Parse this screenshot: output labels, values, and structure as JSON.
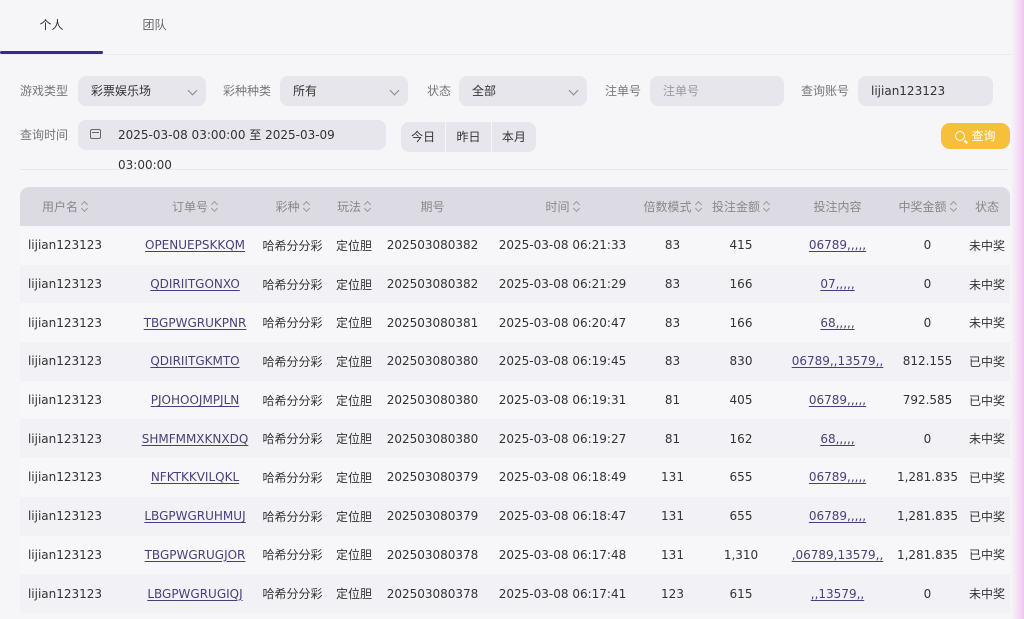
{
  "tabs": [
    {
      "label": "个人"
    },
    {
      "label": "团队"
    }
  ],
  "filters": {
    "game_type": {
      "label": "游戏类型",
      "value": "彩票娱乐场"
    },
    "lottery_kind": {
      "label": "彩种种类",
      "value": "所有"
    },
    "status": {
      "label": "状态",
      "value": "全部"
    },
    "order_no": {
      "label": "注单号",
      "placeholder": "注单号"
    },
    "account": {
      "label": "查询账号",
      "value": "lijian123123"
    },
    "time": {
      "label": "查询时间",
      "value": "2025-03-08 03:00:00 至 2025-03-09 03:00:00"
    },
    "quick": [
      {
        "label": "今日"
      },
      {
        "label": "昨日"
      },
      {
        "label": "本月"
      }
    ],
    "query_button": "查询"
  },
  "table": {
    "headers": {
      "user": "用户名",
      "order": "订单号",
      "lottery": "彩种",
      "play": "玩法",
      "issue": "期号",
      "time": "时间",
      "multiplier": "倍数模式",
      "amount": "投注金额",
      "content": "投注内容",
      "win": "中奖金额",
      "status": "状态"
    },
    "rows": [
      {
        "user": "lijian123123",
        "order": "OPENUEPSKKQM",
        "lottery": "哈希分分彩",
        "play": "定位胆",
        "issue": "202503080382",
        "time": "2025-03-08 06:21:33",
        "multiplier": "83",
        "amount": "415",
        "content": "06789,,,,,",
        "win": "0",
        "status": "未中奖"
      },
      {
        "user": "lijian123123",
        "order": "QDIRIITGONXO",
        "lottery": "哈希分分彩",
        "play": "定位胆",
        "issue": "202503080382",
        "time": "2025-03-08 06:21:29",
        "multiplier": "83",
        "amount": "166",
        "content": "07,,,,,",
        "win": "0",
        "status": "未中奖"
      },
      {
        "user": "lijian123123",
        "order": "TBGPWGRUKPNR",
        "lottery": "哈希分分彩",
        "play": "定位胆",
        "issue": "202503080381",
        "time": "2025-03-08 06:20:47",
        "multiplier": "83",
        "amount": "166",
        "content": "68,,,,,",
        "win": "0",
        "status": "未中奖"
      },
      {
        "user": "lijian123123",
        "order": "QDIRIITGKMTO",
        "lottery": "哈希分分彩",
        "play": "定位胆",
        "issue": "202503080380",
        "time": "2025-03-08 06:19:45",
        "multiplier": "83",
        "amount": "830",
        "content": "06789,,13579,,",
        "win": "812.155",
        "status": "已中奖"
      },
      {
        "user": "lijian123123",
        "order": "PJOHOOJMPJLN",
        "lottery": "哈希分分彩",
        "play": "定位胆",
        "issue": "202503080380",
        "time": "2025-03-08 06:19:31",
        "multiplier": "81",
        "amount": "405",
        "content": "06789,,,,,",
        "win": "792.585",
        "status": "已中奖"
      },
      {
        "user": "lijian123123",
        "order": "SHMFMMXKNXDQ",
        "lottery": "哈希分分彩",
        "play": "定位胆",
        "issue": "202503080380",
        "time": "2025-03-08 06:19:27",
        "multiplier": "81",
        "amount": "162",
        "content": "68,,,,,",
        "win": "0",
        "status": "未中奖"
      },
      {
        "user": "lijian123123",
        "order": "NFKTKKVILQKL",
        "lottery": "哈希分分彩",
        "play": "定位胆",
        "issue": "202503080379",
        "time": "2025-03-08 06:18:49",
        "multiplier": "131",
        "amount": "655",
        "content": "06789,,,,,",
        "win": "1,281.835",
        "status": "已中奖"
      },
      {
        "user": "lijian123123",
        "order": "LBGPWGRUHMUJ",
        "lottery": "哈希分分彩",
        "play": "定位胆",
        "issue": "202503080379",
        "time": "2025-03-08 06:18:47",
        "multiplier": "131",
        "amount": "655",
        "content": "06789,,,,,",
        "win": "1,281.835",
        "status": "已中奖"
      },
      {
        "user": "lijian123123",
        "order": "TBGPWGRUGJOR",
        "lottery": "哈希分分彩",
        "play": "定位胆",
        "issue": "202503080378",
        "time": "2025-03-08 06:17:48",
        "multiplier": "131",
        "amount": "1,310",
        "content": ",06789,13579,,",
        "win": "1,281.835",
        "status": "已中奖"
      },
      {
        "user": "lijian123123",
        "order": "LBGPWGRUGIQJ",
        "lottery": "哈希分分彩",
        "play": "定位胆",
        "issue": "202503080378",
        "time": "2025-03-08 06:17:41",
        "multiplier": "123",
        "amount": "615",
        "content": ",,13579,,",
        "win": "0",
        "status": "未中奖"
      }
    ]
  }
}
